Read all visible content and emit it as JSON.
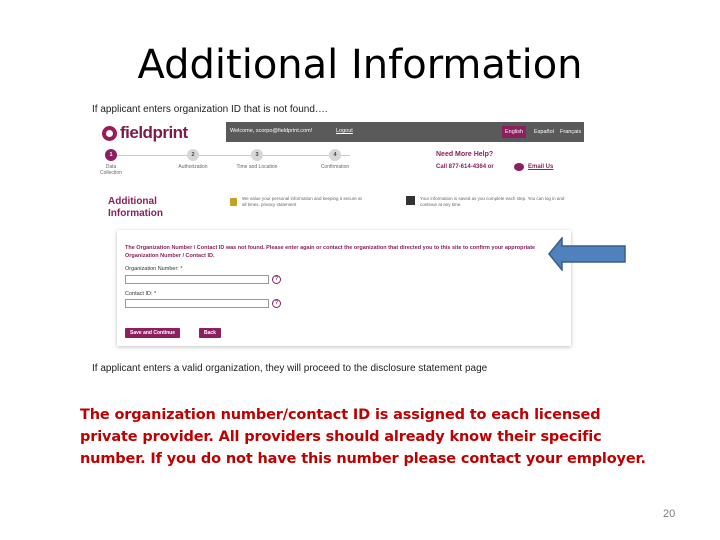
{
  "slide": {
    "title": "Additional Information",
    "caption_top": "If applicant enters organization ID that is not found….",
    "caption_bottom": "If applicant enters a valid organization, they will proceed to the disclosure statement page",
    "body_text": "The organization number/contact ID is assigned to each licensed private provider.  All providers should already know their specific number.  If you do not have this number please contact your employer.",
    "page_number": "20",
    "arrow_color": "#4f81bd",
    "text_color": "#c00000"
  },
  "screenshot": {
    "logo_text": "fieldprint",
    "welcome": "Welcome, scorpo@fieldprint.com!",
    "logout": "Logout",
    "languages": [
      {
        "label": "English",
        "active": true
      },
      {
        "label": "Español",
        "active": false
      },
      {
        "label": "Français",
        "active": false
      }
    ],
    "steps": [
      {
        "num": "1",
        "label": "Data Collection"
      },
      {
        "num": "2",
        "label": "Authorization"
      },
      {
        "num": "3",
        "label": "Time and Location"
      },
      {
        "num": "4",
        "label": "Confirmation"
      }
    ],
    "help_title": "Need More Help?",
    "help_call": "Call 877-614-4364 or",
    "help_email": "Email Us",
    "section_title": "Additional Information",
    "notice_left": "We value your personal information and keeping it secure at all times. privacy statement",
    "notice_right": "Your information is saved as you complete each step. You can log in and continue at any time.",
    "error_text": "The Organization Number / Contact ID was not found. Please enter again or contact the organization that directed you to this site to confirm your appropriate Organization Number / Contact ID.",
    "field_org_label": "Organization Number: *",
    "field_contact_label": "Contact ID: *",
    "btn_save": "Save and Continue",
    "btn_back": "Back",
    "accent_color": "#8c1f5e"
  }
}
